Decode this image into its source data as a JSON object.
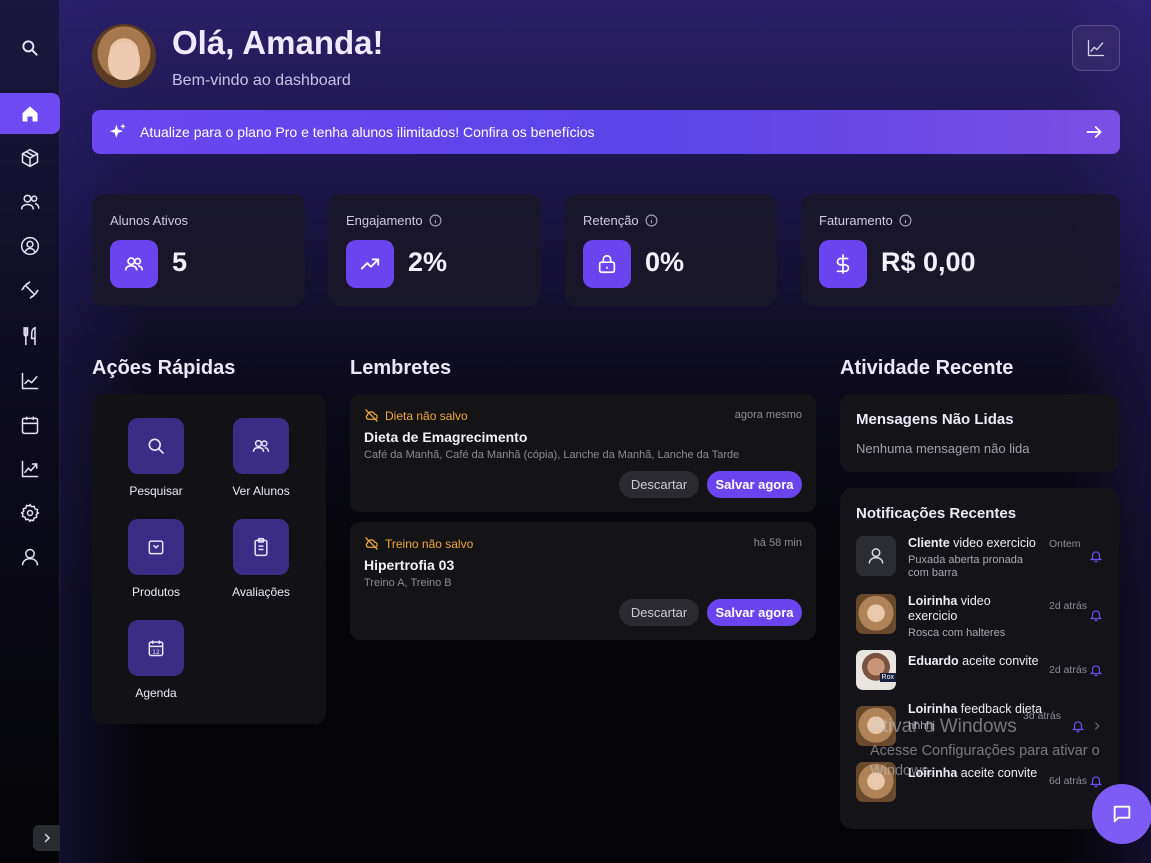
{
  "header": {
    "greeting": "Olá, Amanda!",
    "subtitle": "Bem-vindo ao dashboard"
  },
  "sidebar": {
    "items": [
      {
        "icon": "search-icon"
      },
      {
        "icon": "home-icon",
        "active": true
      },
      {
        "icon": "box-icon"
      },
      {
        "icon": "users-icon"
      },
      {
        "icon": "user-circle-icon"
      },
      {
        "icon": "dumbbell-icon"
      },
      {
        "icon": "utensils-icon"
      },
      {
        "icon": "line-chart-icon"
      },
      {
        "icon": "calendar-icon"
      },
      {
        "icon": "trending-chart-icon"
      },
      {
        "icon": "gear-icon"
      },
      {
        "icon": "user-icon"
      }
    ],
    "expand_icon": "chevron-right-icon"
  },
  "banner": {
    "text": "Atualize para o plano Pro e tenha alunos ilimitados! Confira os benefícios"
  },
  "stats": [
    {
      "label": "Alunos Ativos",
      "value": "5",
      "icon": "users-icon"
    },
    {
      "label": "Engajamento",
      "value": "2%",
      "icon": "trending-up-icon"
    },
    {
      "label": "Retenção",
      "value": "0%",
      "icon": "lock-icon"
    },
    {
      "label": "Faturamento",
      "value": "R$ 0,00",
      "icon": "dollar-icon"
    }
  ],
  "sections": {
    "quick_actions": "Ações Rápidas",
    "reminders": "Lembretes",
    "recent_activity": "Atividade Recente"
  },
  "quick_actions": [
    {
      "label": "Pesquisar",
      "icon": "search-icon"
    },
    {
      "label": "Ver Alunos",
      "icon": "users-icon"
    },
    {
      "label": "Produtos",
      "icon": "package-icon"
    },
    {
      "label": "Avaliações",
      "icon": "clipboard-icon"
    },
    {
      "label": "Agenda",
      "icon": "calendar-icon"
    }
  ],
  "reminders": [
    {
      "tag": "Dieta não salvo",
      "time": "agora mesmo",
      "title": "Dieta de Emagrecimento",
      "subtitle": "Café da Manhã, Café da Manhã (cópia), Lanche da Manhã, Lanche da Tarde",
      "discard": "Descartar",
      "save": "Salvar agora"
    },
    {
      "tag": "Treino não salvo",
      "time": "há 58 min",
      "title": "Hipertrofia 03",
      "subtitle": "Treino A, Treino B",
      "discard": "Descartar",
      "save": "Salvar agora"
    }
  ],
  "messages": {
    "title": "Mensagens Não Lidas",
    "empty": "Nenhuma mensagem não lida"
  },
  "notifications": {
    "title": "Notificações Recentes",
    "items": [
      {
        "name": "Cliente",
        "text": " video exercicio",
        "sub": "Puxada aberta pronada com barra",
        "time": "Ontem"
      },
      {
        "name": "Loirinha",
        "text": " video exercicio",
        "sub": "Rosca com halteres",
        "time": "2d atrás"
      },
      {
        "name": "Eduardo",
        "text": " aceite convite",
        "sub": "",
        "time": "2d atrás"
      },
      {
        "name": "Loirinha",
        "text": " feedback dieta",
        "sub": "hhhhj",
        "time": "3d atrás"
      },
      {
        "name": "Loirinha",
        "text": " aceite convite",
        "sub": "",
        "time": "6d atrás"
      }
    ]
  },
  "watermark": {
    "line1": "Ativar o Windows",
    "line2": "Acesse Configurações para ativar o Windows."
  },
  "colors": {
    "accent": "#6a45ef",
    "warning": "#f2a53a",
    "panel": "#141418"
  }
}
